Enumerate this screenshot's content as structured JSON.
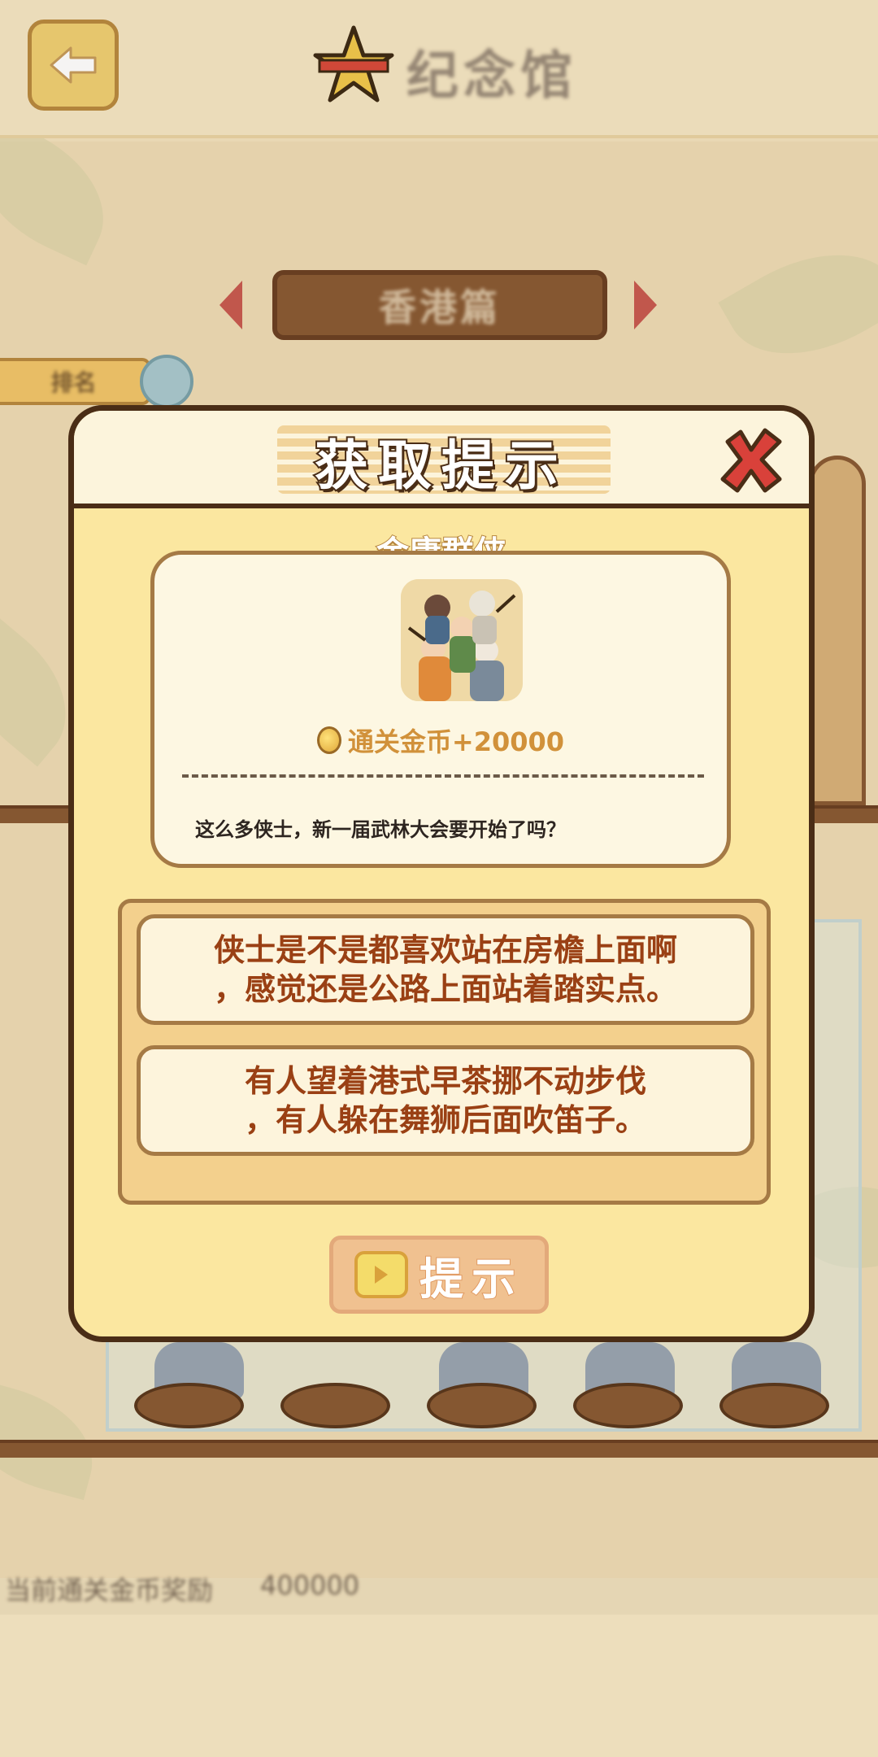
{
  "header": {
    "back_icon": "back-arrow-icon",
    "title": "纪念馆"
  },
  "background": {
    "chapter_label": "香港篇",
    "side_tab_label": "排名",
    "bottom_label": "当前通关金币奖励",
    "bottom_value": "400000"
  },
  "dialog": {
    "title": "获取提示",
    "close_icon": "close-x-icon",
    "item": {
      "name": "金庸群侠",
      "reward": "通关金币+20000",
      "flavor": "这么多侠士，新一届武林大会要开始了吗？"
    },
    "hints": [
      {
        "text": "侠士是不是都喜欢站在房檐上面啊\n，感觉还是公路上面站着踏实点。"
      },
      {
        "text": "有人望着港式早茶挪不动步伐\n，有人躲在舞狮后面吹笛子。"
      }
    ],
    "hint_button_label": "提示"
  },
  "colors": {
    "dialog_border": "#4a2d16",
    "dialog_bg": "#fbe7a0",
    "hint_text": "#9a4014",
    "reward_text": "#d1913a"
  }
}
